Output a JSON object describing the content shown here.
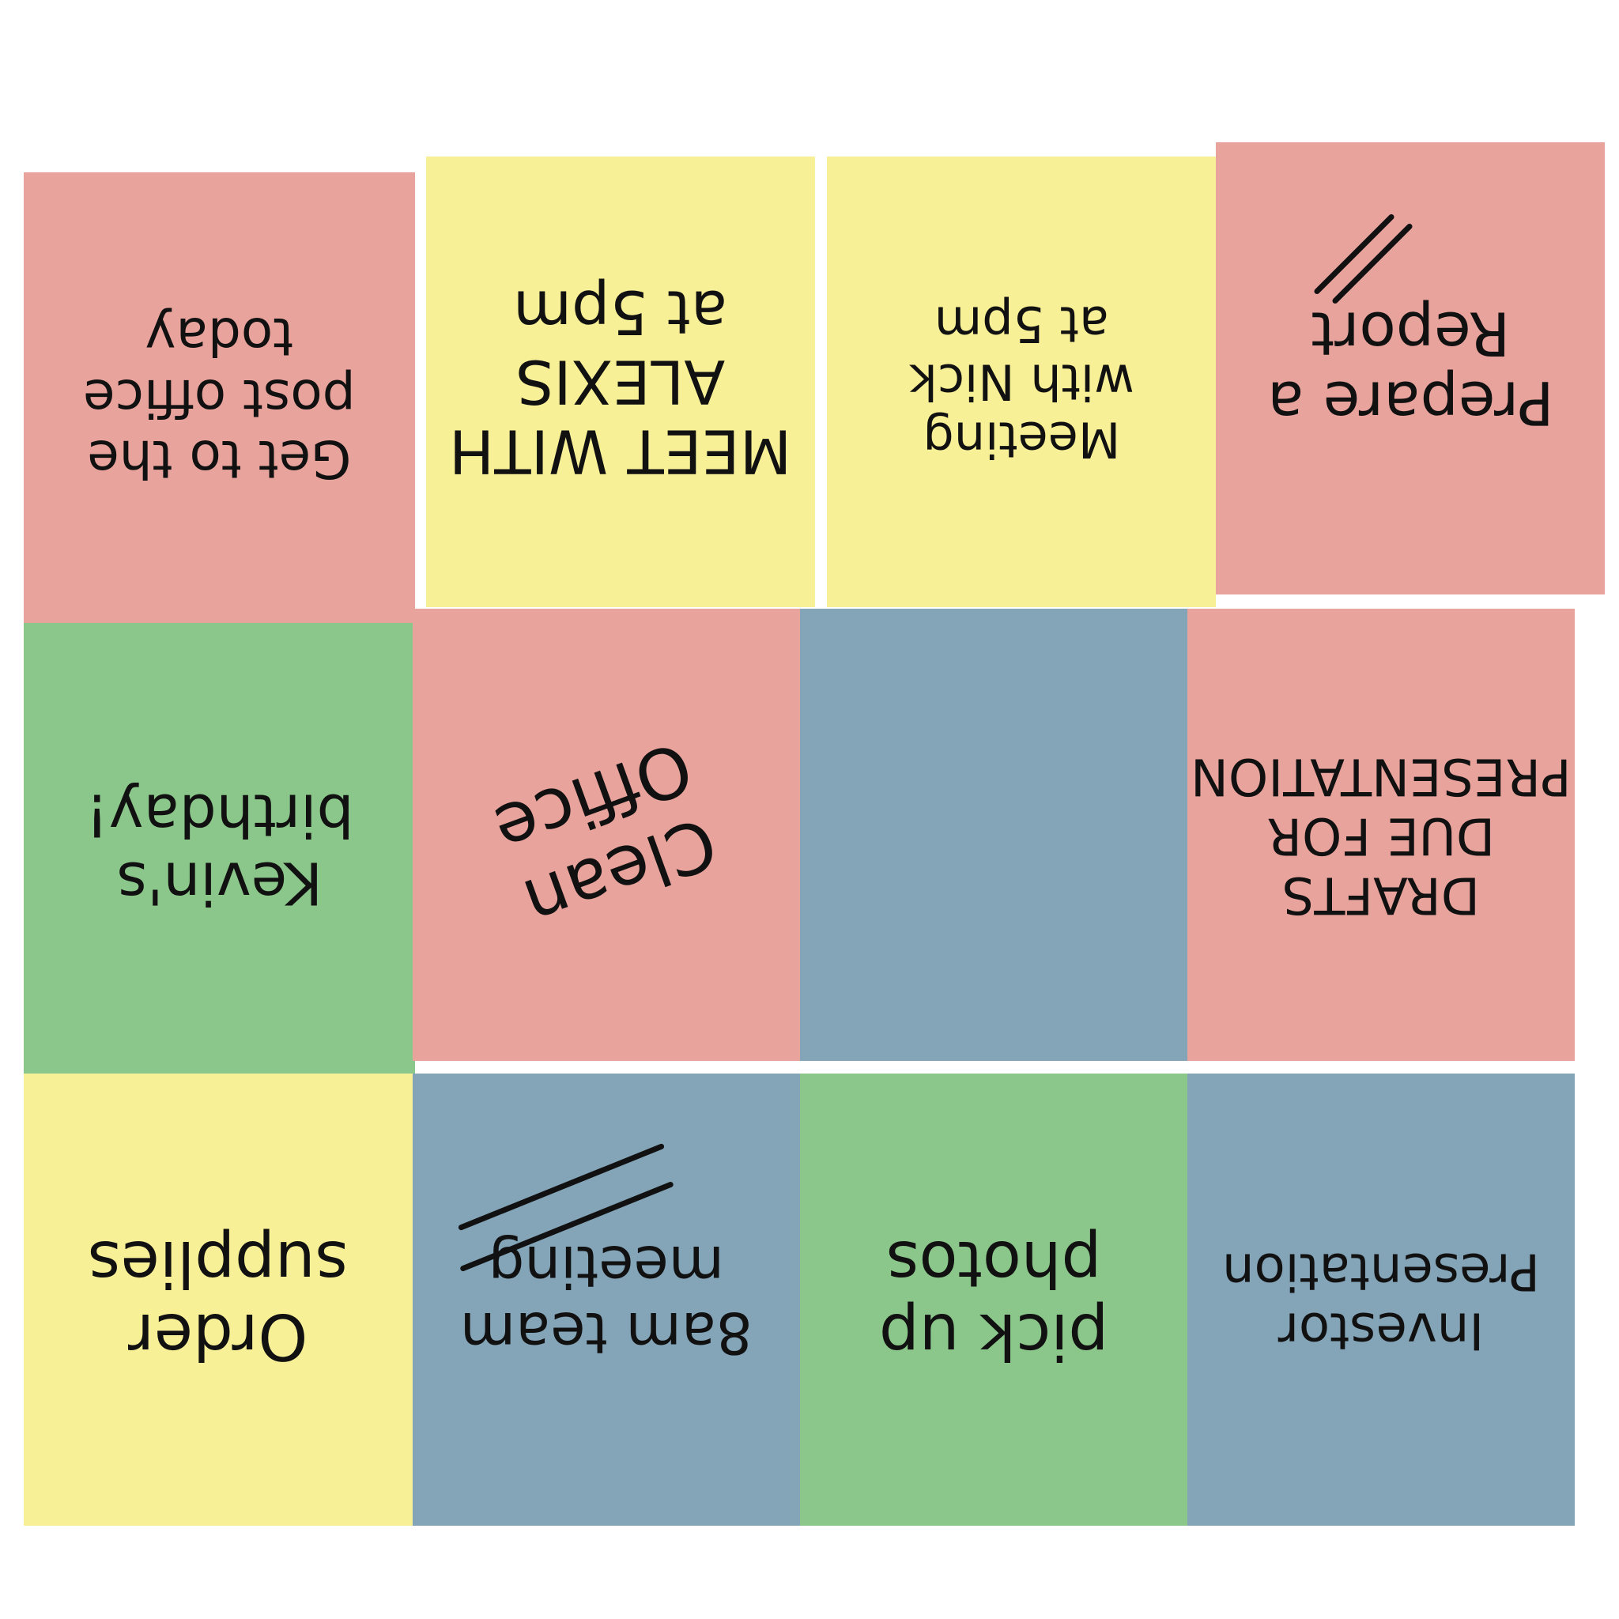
{
  "colors": {
    "red": "#E8A39C",
    "yellow": "#F8F097",
    "green": "#8BC68A",
    "blue": "#84A4B8"
  },
  "notes": {
    "post_office": {
      "color": "red",
      "lines": [
        "Get to the",
        "post office",
        "today"
      ]
    },
    "alexis": {
      "color": "yellow",
      "lines": [
        "MEET WITH",
        "ALEXIS",
        "at 5pm"
      ]
    },
    "nick": {
      "color": "yellow",
      "lines": [
        "Meeting",
        "with Nick",
        "at 5pm"
      ]
    },
    "report": {
      "color": "red",
      "lines": [
        "Prepare a",
        "Report"
      ],
      "has_strike": true
    },
    "kevin": {
      "color": "green",
      "lines": [
        "Kevin's",
        "birthday!"
      ]
    },
    "clean_office": {
      "color": "red",
      "lines": [
        "Clean",
        "Office"
      ]
    },
    "blank": {
      "color": "blue",
      "lines": []
    },
    "drafts": {
      "color": "red",
      "lines": [
        "DRAFTS",
        "DUE FOR",
        "PRESENTATION"
      ]
    },
    "supplies": {
      "color": "yellow",
      "lines": [
        "Order",
        "supplies"
      ]
    },
    "team_meeting": {
      "color": "blue",
      "lines": [
        "8am team",
        "meeting"
      ],
      "has_strike": true
    },
    "photos": {
      "color": "green",
      "lines": [
        "pick up",
        "photos"
      ]
    },
    "investor": {
      "color": "blue",
      "lines": [
        "Investor",
        "Presentation"
      ]
    }
  }
}
